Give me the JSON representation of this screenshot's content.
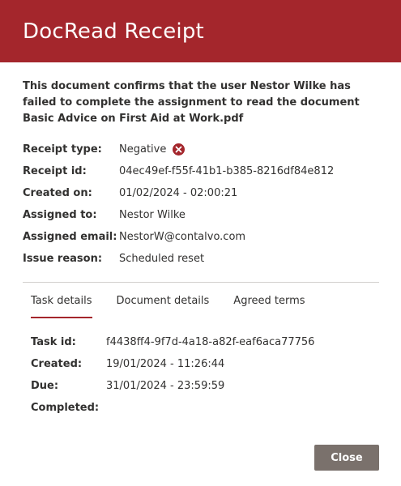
{
  "header": {
    "title": "DocRead Receipt",
    "color": "#a4262c"
  },
  "intro": "This document confirms that the user Nestor Wilke has failed to complete the assignment to read the document Basic Advice on First Aid at Work.pdf",
  "receipt": {
    "type_label": "Receipt type:",
    "type_value": "Negative",
    "type_icon": "x-circle-icon",
    "id_label": "Receipt id:",
    "id_value": "04ec49ef-f55f-41b1-b385-8216df84e812",
    "created_label": "Created on:",
    "created_value": "01/02/2024 - 02:00:21",
    "assigned_label": "Assigned to:",
    "assigned_value": "Nestor Wilke",
    "email_label": "Assigned email:",
    "email_value": "NestorW@contalvo.com",
    "reason_label": "Issue reason:",
    "reason_value": "Scheduled reset"
  },
  "tabs": [
    {
      "label": "Task details",
      "active": true
    },
    {
      "label": "Document details",
      "active": false
    },
    {
      "label": "Agreed terms",
      "active": false
    }
  ],
  "task": {
    "id_label": "Task id:",
    "id_value": "f4438ff4-9f7d-4a18-a82f-eaf6aca77756",
    "created_label": "Created:",
    "created_value": "19/01/2024 - 11:26:44",
    "due_label": "Due:",
    "due_value": "31/01/2024 - 23:59:59",
    "completed_label": "Completed:",
    "completed_value": ""
  },
  "footer": {
    "close_label": "Close"
  }
}
